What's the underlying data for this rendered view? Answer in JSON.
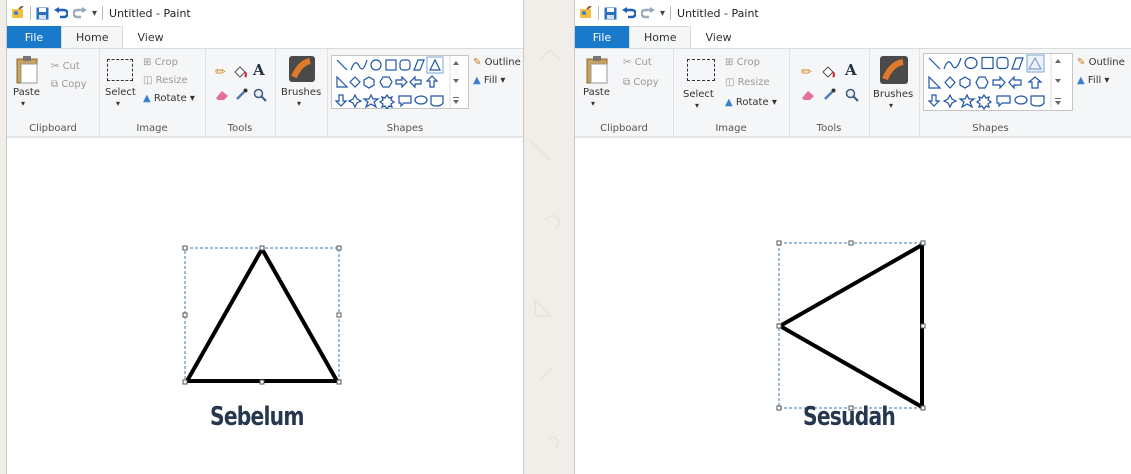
{
  "panels": [
    {
      "title": "Untitled - Paint",
      "tabs": [
        "File",
        "Home",
        "View"
      ],
      "clipboard": {
        "paste": "Paste",
        "cut": "Cut",
        "copy": "Copy",
        "label": "Clipboard"
      },
      "image": {
        "select": "Select",
        "crop": "Crop",
        "resize": "Resize",
        "rotate": "Rotate",
        "label": "Image"
      },
      "tools": {
        "label": "Tools",
        "text_tool": "A"
      },
      "brushes": "Brushes",
      "shapes": {
        "label": "Shapes",
        "outline": "Outline",
        "fill": "Fill"
      },
      "caption": "Sebelum"
    },
    {
      "title": "Untitled - Paint",
      "tabs": [
        "File",
        "Home",
        "View"
      ],
      "clipboard": {
        "paste": "Paste",
        "cut": "Cut",
        "copy": "Copy",
        "label": "Clipboard"
      },
      "image": {
        "select": "Select",
        "crop": "Crop",
        "resize": "Resize",
        "rotate": "Rotate",
        "label": "Image"
      },
      "tools": {
        "label": "Tools",
        "text_tool": "A"
      },
      "brushes": "Brushes",
      "shapes": {
        "label": "Shapes",
        "outline": "Outline",
        "fill": "Fill"
      },
      "caption": "Sesudah"
    }
  ],
  "colors": {
    "file_tab": "#1979ca",
    "ribbon": "#f5f6f7",
    "selection": "#3c78b4",
    "caption": "#26384f"
  }
}
